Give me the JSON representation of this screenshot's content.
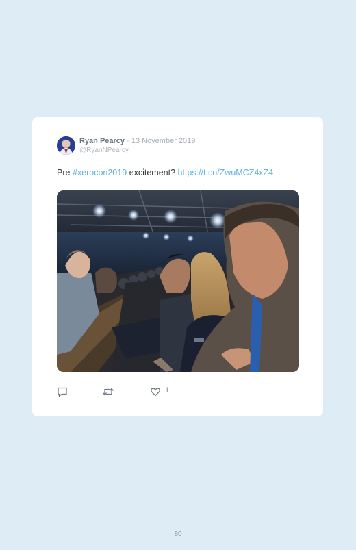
{
  "tweet": {
    "author_name": "Ryan Pearcy",
    "separator": " · ",
    "date": "13 November 2019",
    "handle": "@RyanNPearcy",
    "text_prefix": "Pre ",
    "hashtag": "#xerocon2019",
    "text_middle": " excitement? ",
    "link": "https://t.co/ZwuMCZ4xZ4",
    "photo_icon": "conference-audience-photo",
    "actions": {
      "reply_icon": "reply-icon",
      "retweet_icon": "retweet-icon",
      "like_icon": "heart-icon",
      "like_count": "1"
    }
  },
  "page": {
    "number": "80"
  },
  "colors": {
    "background": "#deecf5",
    "card": "#ffffff",
    "link": "#5fb2e0",
    "name": "#65707a",
    "muted": "#a6aeb6"
  }
}
